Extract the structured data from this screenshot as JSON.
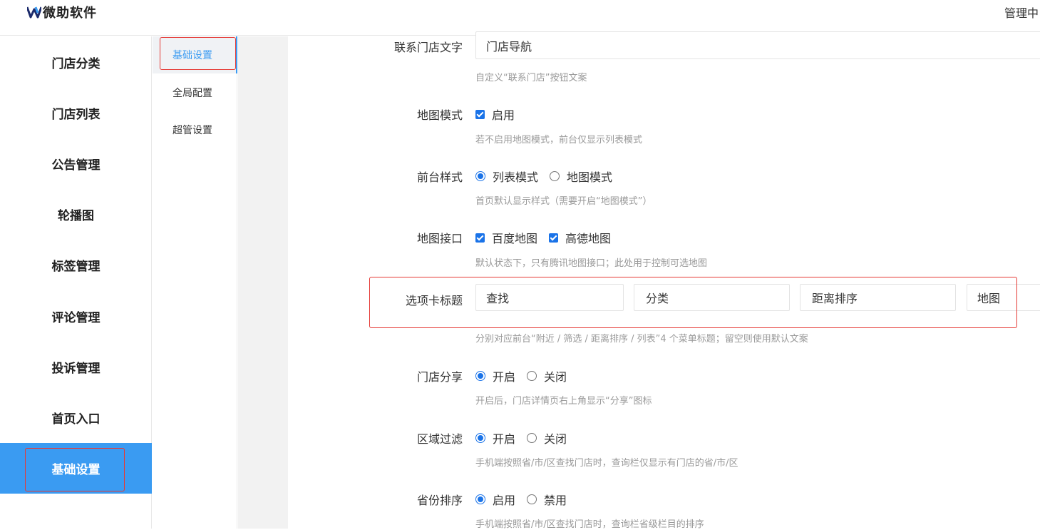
{
  "header": {
    "logo_text": "微助软件",
    "right_text": "管理中"
  },
  "leftnav": {
    "items": [
      {
        "label": "门店分类"
      },
      {
        "label": "门店列表"
      },
      {
        "label": "公告管理"
      },
      {
        "label": "轮播图"
      },
      {
        "label": "标签管理"
      },
      {
        "label": "评论管理"
      },
      {
        "label": "投诉管理"
      },
      {
        "label": "首页入口"
      },
      {
        "label": "基础设置",
        "active": true
      }
    ]
  },
  "subnav": {
    "items": [
      {
        "label": "基础设置",
        "active": true
      },
      {
        "label": "全局配置"
      },
      {
        "label": "超管设置"
      }
    ]
  },
  "form": {
    "contact_text": {
      "label": "联系门店文字",
      "value": "门店导航",
      "help": "自定义“联系门店”按钮文案"
    },
    "map_mode": {
      "label": "地图模式",
      "option": "启用",
      "checked": true,
      "help": "若不启用地图模式，前台仅显示列表模式"
    },
    "front_style": {
      "label": "前台样式",
      "options": [
        "列表模式",
        "地图模式"
      ],
      "selected": "列表模式",
      "help": "首页默认显示样式（需要开启“地图模式”）"
    },
    "map_api": {
      "label": "地图接口",
      "options": [
        "百度地图",
        "高德地图"
      ],
      "help": "默认状态下，只有腾讯地图接口；此处用于控制可选地图"
    },
    "tab_titles": {
      "label": "选项卡标题",
      "values": [
        "查找",
        "分类",
        "距离排序",
        "地图"
      ],
      "help": "分别对应前台“附近 / 筛选 / 距离排序 / 列表”4 个菜单标题；留空则使用默认文案"
    },
    "store_share": {
      "label": "门店分享",
      "options": [
        "开启",
        "关闭"
      ],
      "selected": "开启",
      "help": "开启后，门店详情页右上角显示“分享”图标"
    },
    "region_filter": {
      "label": "区域过滤",
      "options": [
        "开启",
        "关闭"
      ],
      "selected": "开启",
      "help": "手机端按照省/市/区查找门店时，查询栏仅显示有门店的省/市/区"
    },
    "province_sort": {
      "label": "省份排序",
      "options": [
        "启用",
        "禁用"
      ],
      "selected": "启用",
      "help": "手机端按照省/市/区查找门店时，查询栏省级栏目的排序"
    }
  },
  "colors": {
    "accent": "#3a9bf2",
    "checkbox": "#1a73e8",
    "highlight": "#e53935"
  }
}
